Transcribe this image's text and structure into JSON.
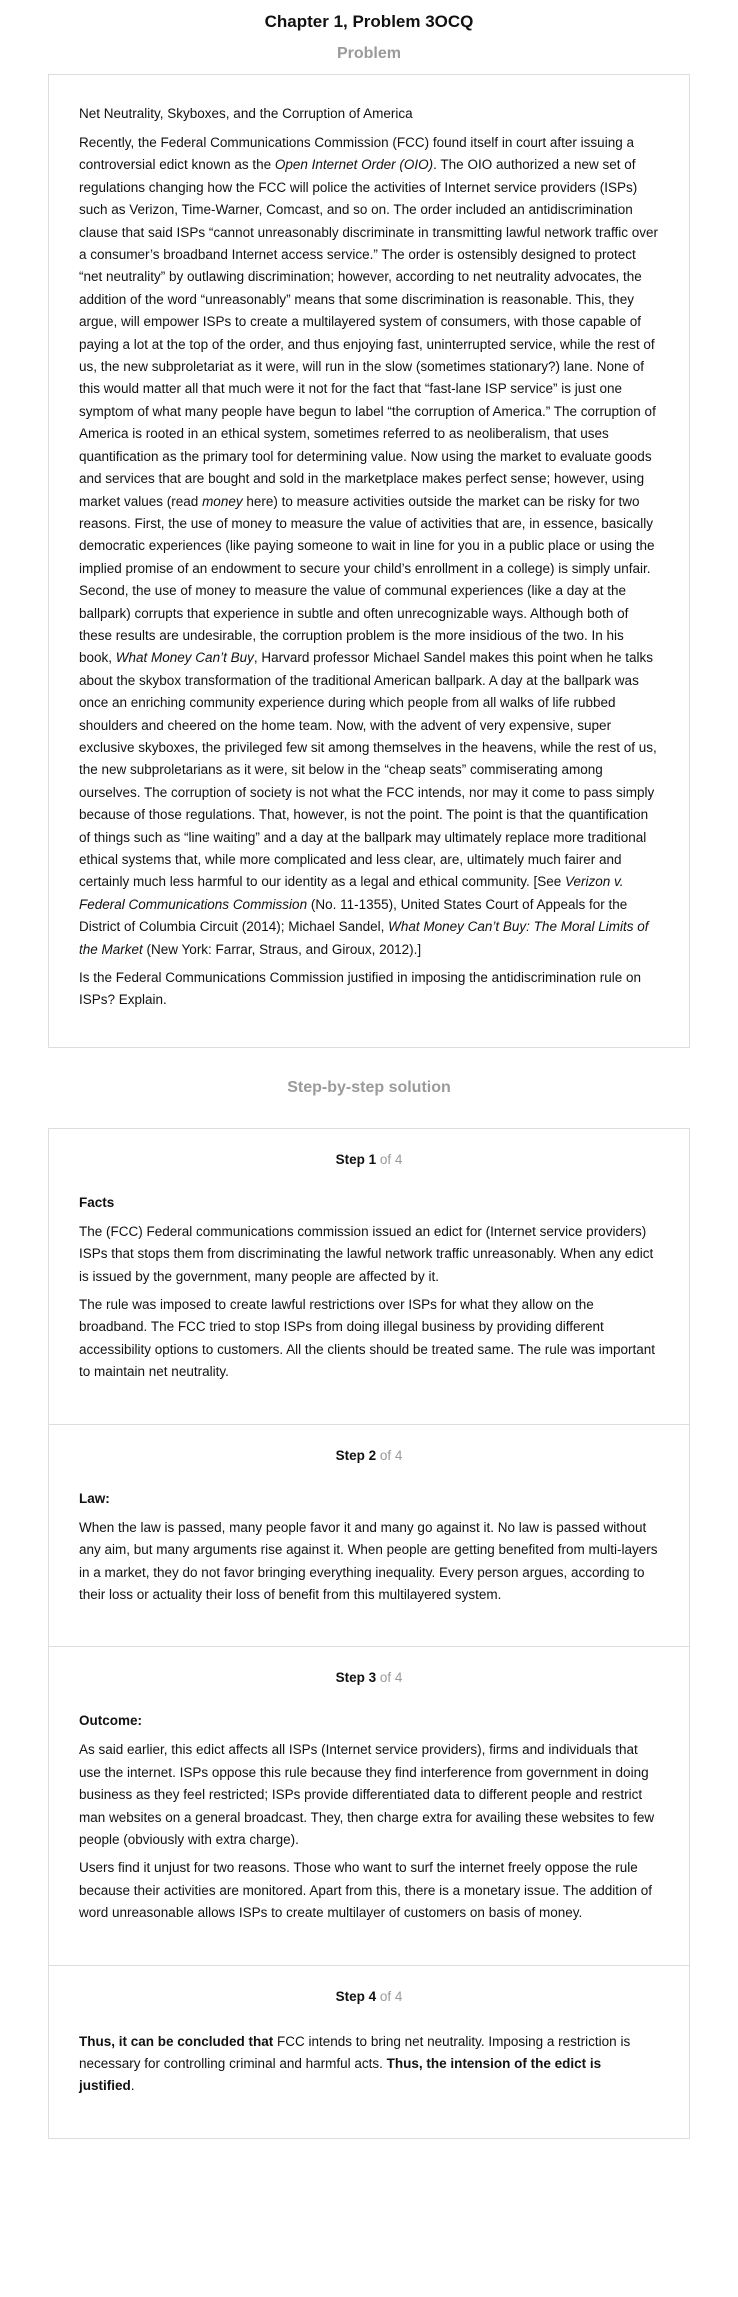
{
  "page": {
    "title": "Chapter 1, Problem 3OCQ",
    "problem_label": "Problem",
    "solution_label": "Step-by-step solution"
  },
  "problem": {
    "heading": "Net Neutrality, Skyboxes, and the Corruption of America",
    "body": [
      "Recently, the Federal Communications Commission (FCC) found itself in court after issuing a controversial edict known as the ",
      "Open Internet Order (OIO)",
      ". The OIO authorized a new set of regulations changing how the FCC will police the activities of Internet service providers (ISPs) such as Verizon, Time-Warner, Comcast, and so on. The order included an antidiscrimination clause that said ISPs “cannot unreasonably discriminate in transmitting lawful network traffic over a consumer’s broadband Internet access service.” The order is ostensibly designed to protect “net neutrality” by outlawing discrimination; however, according to net neutrality advocates, the addition of the word “unreasonably” means that some discrimination is reasonable. This, they argue, will empower ISPs to create a multilayered system of consumers, with those capable of paying a lot at the top of the order, and thus enjoying fast, uninterrupted service, while the rest of us, the new subproletariat as it were, will run in the slow (sometimes stationary?) lane. None of this would matter all that much were it not for the fact that “fast-lane ISP service” is just one symptom of what many people have begun to label “the corruption of America.” The corruption of America is rooted in an ethical system, sometimes referred to as neoliberalism, that uses quantification as the primary tool for determining value. Now using the market to evaluate goods and services that are bought and sold in the marketplace makes perfect sense; however, using market values (read ",
      "money",
      " here) to measure activities outside the market can be risky for two reasons. First, the use of money to measure the value of activities that are, in essence, basically democratic experiences (like paying someone to wait in line for you in a public place or using the implied promise of an endowment to secure your child’s enrollment in a college) is simply unfair. Second, the use of money to measure the value of communal experiences (like a day at the ballpark) corrupts that experience in subtle and often unrecognizable ways. Although both of these results are undesirable, the corruption problem is the more insidious of the two. In his book, ",
      "What Money Can’t Buy",
      ", Harvard professor Michael Sandel makes this point when he talks about the skybox transformation of the traditional American ballpark. A day at the ballpark was once an enriching community experience during which people from all walks of life rubbed shoulders and cheered on the home team. Now, with the advent of very expensive, super exclusive skyboxes, the privileged few sit among themselves in the heavens, while the rest of us, the new subproletarians as it were, sit below in the “cheap seats” commiserating among ourselves. The corruption of society is not what the FCC intends, nor may it come to pass simply because of those regulations. That, however, is not the point. The point is that the quantification of things such as “line waiting” and a day at the ballpark may ultimately replace more traditional ethical systems that, while more complicated and less clear, are, ultimately much fairer and certainly much less harmful to our identity as a legal and ethical community. [See ",
      "Verizon v. Federal Communications Commission",
      " (No. 11-1355), United States Court of Appeals for the District of Columbia Circuit (2014); Michael Sandel, ",
      "What Money Can’t Buy: The Moral Limits of the Market",
      " (New York: Farrar, Straus, and Giroux, 2012).]"
    ],
    "question": "Is the Federal Communications Commission justified in imposing the antidiscrimination rule on ISPs? Explain."
  },
  "steps": [
    {
      "num": "Step 1",
      "of": "of 4",
      "heading": "Facts",
      "paragraphs": [
        "The (FCC) Federal communications commission issued an edict for (Internet service providers) ISPs that stops them from discriminating the lawful network traffic unreasonably. When any edict is issued by the government, many people are affected by it.",
        "The rule was imposed to create lawful restrictions over ISPs for what they allow on the broadband. The FCC tried to stop ISPs from doing illegal business by providing different accessibility options to customers. All the clients should be treated same. The rule was important to maintain net neutrality."
      ]
    },
    {
      "num": "Step 2",
      "of": "of 4",
      "heading": "Law:",
      "paragraphs": [
        "When the law is passed, many people favor it and many go against it. No law is passed without any aim, but many arguments rise against it. When people are getting benefited from multi-layers in a market, they do not favor bringing everything inequality. Every person argues, according to their loss or actuality their loss of benefit from this multilayered system."
      ]
    },
    {
      "num": "Step 3",
      "of": "of 4",
      "heading": "Outcome:",
      "paragraphs": [
        "As said earlier, this edict affects all ISPs (Internet service providers), firms and individuals that use the internet. ISPs oppose this rule because they find interference from government in doing business as they feel restricted; ISPs provide differentiated data to different people and restrict man websites on a general broadcast. They, then charge extra for availing these websites to few people (obviously with extra charge).",
        "Users find it unjust for two reasons. Those who want to surf the internet freely oppose the rule because their activities are monitored. Apart from this, there is a monetary issue. The addition of word unreasonable allows ISPs to create multilayer of customers on basis of money."
      ]
    },
    {
      "num": "Step 4",
      "of": "of 4",
      "conclusion": [
        "Thus, it can be concluded that",
        " FCC intends to bring net neutrality. Imposing a restriction is necessary for controlling criminal and harmful acts. ",
        "Thus, the intension of the edict is justified",
        "."
      ]
    }
  ]
}
